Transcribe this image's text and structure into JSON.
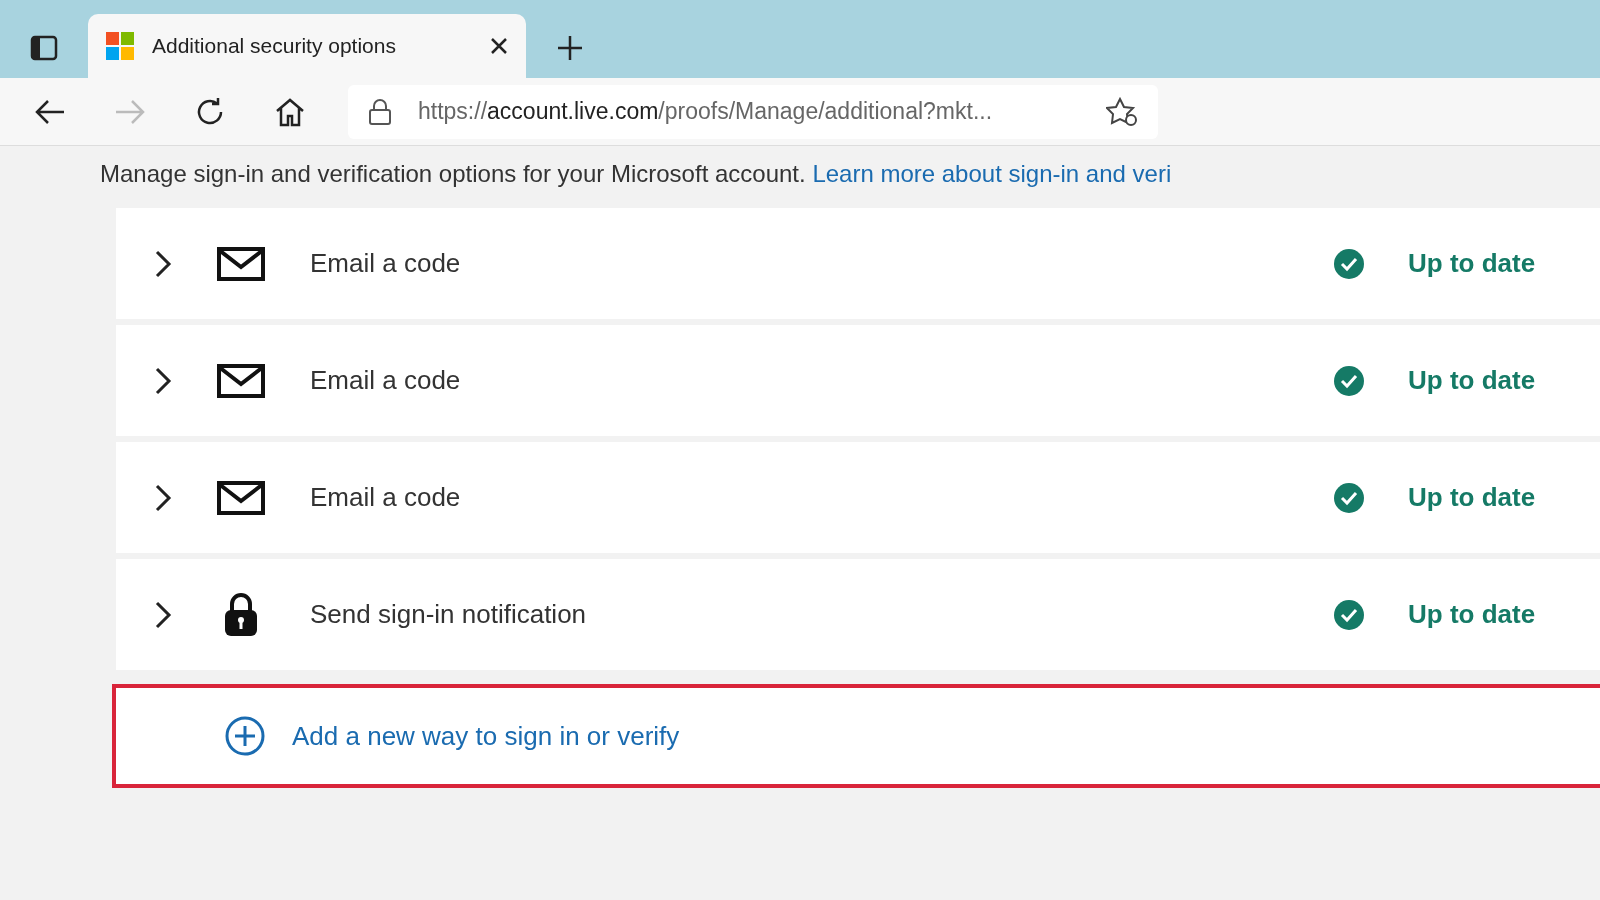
{
  "tab": {
    "title": "Additional security options",
    "selected": true
  },
  "address": {
    "scheme": "https://",
    "host": "account.live.com",
    "path": "/proofs/Manage/additional?mkt..."
  },
  "intro": {
    "text": "Manage sign-in and verification options for your Microsoft account.",
    "link": "Learn more about sign-in and veri"
  },
  "methods": [
    {
      "kind": "email",
      "label": "Email a code",
      "status": "Up to date"
    },
    {
      "kind": "email",
      "label": "Email a code",
      "status": "Up to date"
    },
    {
      "kind": "email",
      "label": "Email a code",
      "status": "Up to date"
    },
    {
      "kind": "notification",
      "label": "Send sign-in notification",
      "status": "Up to date"
    }
  ],
  "add": {
    "label": "Add a new way to sign in or verify",
    "highlighted": true
  }
}
